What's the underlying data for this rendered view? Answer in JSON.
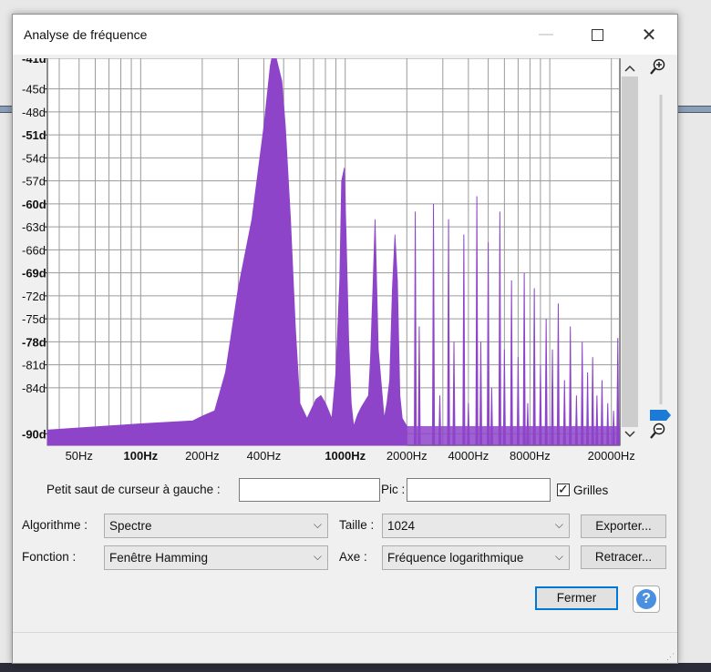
{
  "window": {
    "title": "Analyse de fréquence",
    "close_glyph": "✕"
  },
  "chart_data": {
    "type": "area",
    "x_scale": "log",
    "grid": true,
    "color": "#8e44c9",
    "y_tick_labels": [
      "-41d",
      "-45d",
      "-48d",
      "-51d",
      "-54d",
      "-57d",
      "-60d",
      "-63d",
      "-66d",
      "-69d",
      "-72d",
      "-75d",
      "-78d",
      "-81d",
      "-84d",
      "-90d"
    ],
    "y_ticks": [
      -41,
      -45,
      -48,
      -51,
      -54,
      -57,
      -60,
      -63,
      -66,
      -69,
      -72,
      -75,
      -78,
      -81,
      -84,
      -90
    ],
    "x_tick_labels": [
      "50Hz",
      "100Hz",
      "200Hz",
      "400Hz",
      "1000Hz",
      "2000Hz",
      "4000Hz",
      "8000Hz",
      "20000Hz"
    ],
    "x_ticks": [
      50,
      100,
      200,
      400,
      1000,
      2000,
      4000,
      8000,
      20000
    ],
    "xlim": [
      35,
      22000
    ],
    "ylim": [
      -91.5,
      -41
    ],
    "x": [
      35,
      100,
      180,
      200,
      230,
      260,
      300,
      350,
      400,
      430,
      440,
      460,
      490,
      510,
      540,
      570,
      600,
      650,
      720,
      760,
      800,
      860,
      900,
      920,
      940,
      960,
      990,
      1010,
      1040,
      1070,
      1100,
      1150,
      1200,
      1300,
      1330,
      1370,
      1400,
      1450,
      1550,
      1600,
      1650,
      1700,
      1750,
      1800,
      1850,
      1900,
      2000
    ],
    "y": [
      -89.5,
      -88.7,
      -88.3,
      -87.7,
      -87,
      -82,
      -71,
      -62,
      -50,
      -42,
      -40.7,
      -41,
      -44,
      -50,
      -62,
      -76,
      -86,
      -88,
      -85.5,
      -85,
      -86,
      -88,
      -82,
      -76,
      -70,
      -57,
      -55.3,
      -64,
      -78,
      -86,
      -89,
      -87.5,
      -86.5,
      -85,
      -80,
      -70,
      -62,
      -79,
      -88,
      -86,
      -83,
      -71,
      -64,
      -70,
      -85,
      -88,
      -89
    ],
    "spikes": [
      {
        "x": 2200,
        "y": -61
      },
      {
        "x": 2300,
        "y": -76
      },
      {
        "x": 2700,
        "y": -60
      },
      {
        "x": 2900,
        "y": -85
      },
      {
        "x": 3200,
        "y": -62
      },
      {
        "x": 3400,
        "y": -78
      },
      {
        "x": 3800,
        "y": -64
      },
      {
        "x": 4000,
        "y": -86
      },
      {
        "x": 4400,
        "y": -59
      },
      {
        "x": 4600,
        "y": -78
      },
      {
        "x": 5000,
        "y": -65
      },
      {
        "x": 5200,
        "y": -84
      },
      {
        "x": 5700,
        "y": -61
      },
      {
        "x": 6000,
        "y": -79
      },
      {
        "x": 6500,
        "y": -70
      },
      {
        "x": 7000,
        "y": -80
      },
      {
        "x": 7500,
        "y": -69
      },
      {
        "x": 7800,
        "y": -86
      },
      {
        "x": 8400,
        "y": -71
      },
      {
        "x": 9000,
        "y": -81
      },
      {
        "x": 9600,
        "y": -75
      },
      {
        "x": 10300,
        "y": -79
      },
      {
        "x": 11000,
        "y": -73
      },
      {
        "x": 11800,
        "y": -83
      },
      {
        "x": 12600,
        "y": -76
      },
      {
        "x": 13500,
        "y": -85
      },
      {
        "x": 14400,
        "y": -78
      },
      {
        "x": 15300,
        "y": -82
      },
      {
        "x": 16200,
        "y": -80
      },
      {
        "x": 17000,
        "y": -85
      },
      {
        "x": 18000,
        "y": -83
      },
      {
        "x": 19200,
        "y": -86
      },
      {
        "x": 20500,
        "y": -87
      },
      {
        "x": 21500,
        "y": -77.5
      }
    ],
    "baseline": -89
  },
  "controls": {
    "cursor_label": "Petit saut de curseur à gauche :",
    "peak_label": "Pic :",
    "grid_label": "Grilles",
    "grid_checked": "✓",
    "algorithm_label": "Algorithme :",
    "algorithm_value": "Spectre",
    "size_label": "Taille :",
    "size_value": "1024",
    "function_label": "Fonction :",
    "function_value": "Fenêtre Hamming",
    "axis_label": "Axe :",
    "axis_value": "Fréquence logarithmique",
    "export_button": "Exporter...",
    "replot_button": "Retracer...",
    "close_button": "Fermer",
    "help_button": "?",
    "dropdown_glyph": "⌵"
  }
}
